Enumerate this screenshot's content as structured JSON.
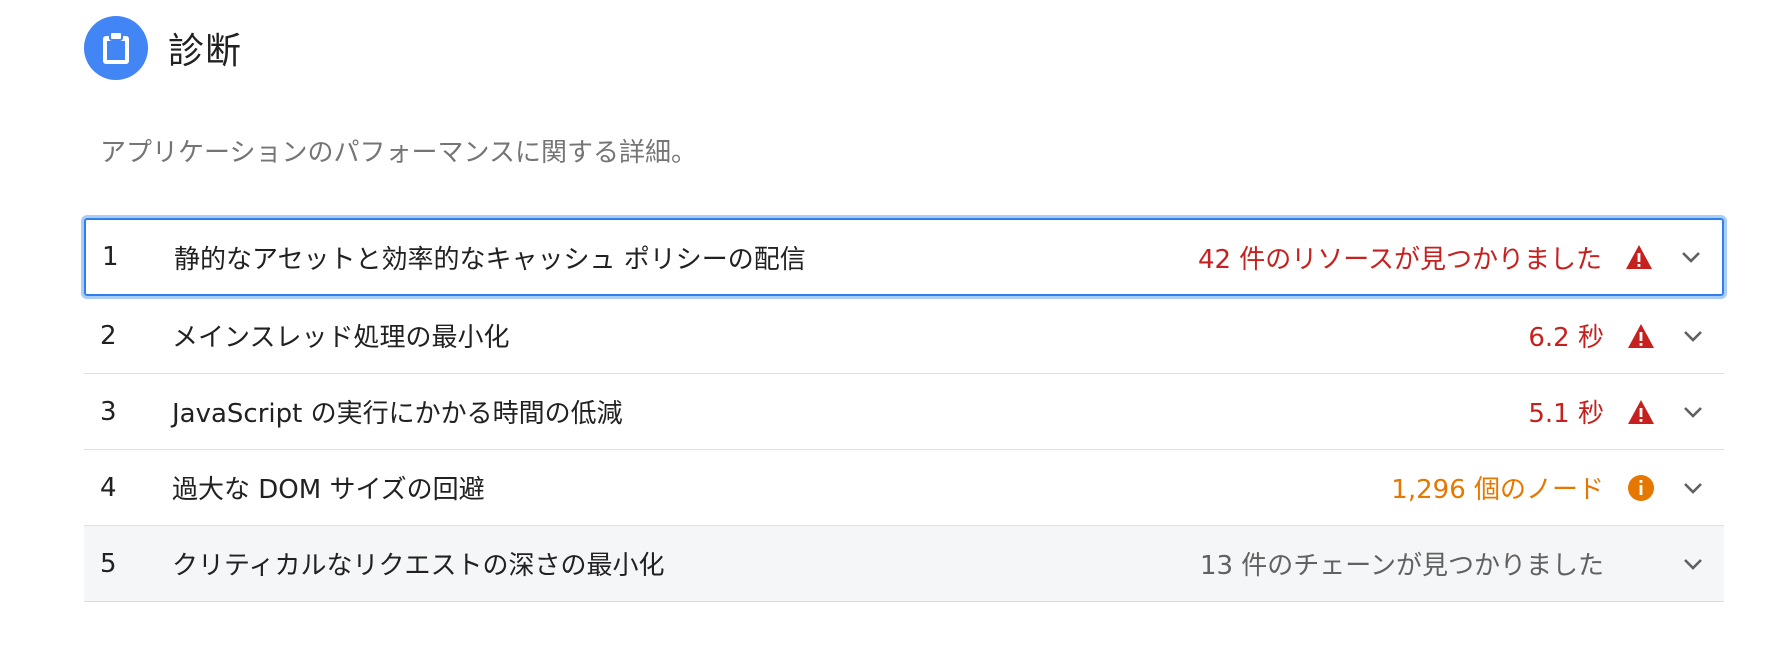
{
  "section": {
    "title": "診断",
    "icon": "clipboard-icon",
    "description": "アプリケーションのパフォーマンスに関する詳細。",
    "accent_color": "#4285f4"
  },
  "audits": [
    {
      "index": "1",
      "title": "静的なアセットと効率的なキャッシュ ポリシーの配信",
      "value": "42 件のリソースが見つかりました",
      "status": "fail",
      "status_icon": "warning-triangle-icon",
      "focused": true
    },
    {
      "index": "2",
      "title": "メインスレッド処理の最小化",
      "value": "6.2 秒",
      "status": "fail",
      "status_icon": "warning-triangle-icon"
    },
    {
      "index": "3",
      "title": "JavaScript の実行にかかる時間の低減",
      "value": "5.1 秒",
      "status": "fail",
      "status_icon": "warning-triangle-icon"
    },
    {
      "index": "4",
      "title": "過大な DOM サイズの回避",
      "value": "1,296 個のノード",
      "status": "average",
      "status_icon": "info-circle-icon"
    },
    {
      "index": "5",
      "title": "クリティカルなリクエストの深さの最小化",
      "value": "13 件のチェーンが見つかりました",
      "status": "neutral",
      "status_icon": ""
    }
  ],
  "colors": {
    "fail": "#c5221f",
    "average": "#e67700",
    "neutral": "#616161",
    "focus": "#2f80ed"
  }
}
